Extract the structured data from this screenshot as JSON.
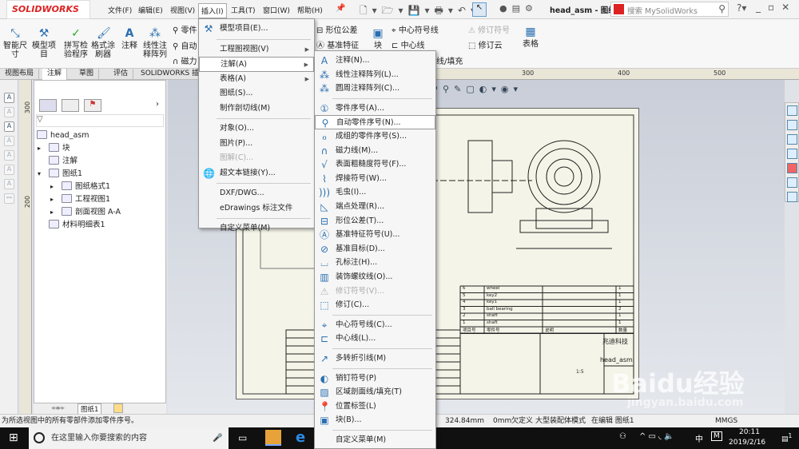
{
  "app": {
    "logo": "SOLIDWORKS",
    "doc_title": "head_asm - 图纸...",
    "search_placeholder": "搜索 MySolidWorks"
  },
  "menubar": [
    "文件(F)",
    "编辑(E)",
    "视图(V)",
    "插入(I)",
    "工具(T)",
    "窗口(W)",
    "帮助(H)"
  ],
  "ribbon": {
    "buttons": [
      "智能尺寸",
      "模型项目",
      "拼写检验程序",
      "格式涂刷器",
      "注释",
      "线性注释阵列"
    ],
    "small": [
      "零件",
      "自动",
      "磁力"
    ],
    "right_small": [
      "形位公差",
      "基准特征"
    ],
    "block": "块",
    "far": [
      "中心符号线",
      "中心线",
      "线/填充",
      "修订符号",
      "修订云"
    ],
    "table": "表格"
  },
  "tabs": [
    "视图布局",
    "注解",
    "草图",
    "评估",
    "SOLIDWORKS 插件"
  ],
  "active_tab": "注解",
  "ruler": {
    "vertical": [
      "300",
      "200"
    ],
    "horizontal": [
      "300",
      "400",
      "500"
    ]
  },
  "tree": {
    "root": "head_asm",
    "items": [
      {
        "label": "块",
        "level": 1,
        "expand": "▸"
      },
      {
        "label": "注解",
        "level": 1,
        "expand": ""
      },
      {
        "label": "图纸1",
        "level": 1,
        "expand": "▾"
      },
      {
        "label": "图纸格式1",
        "level": 2,
        "expand": "▸"
      },
      {
        "label": "工程视图1",
        "level": 2,
        "expand": "▸"
      },
      {
        "label": "剖面视图 A-A",
        "level": 2,
        "expand": "▸"
      },
      {
        "label": "材料明细表1",
        "level": 1,
        "expand": ""
      }
    ]
  },
  "sheet_tab": "图纸1",
  "insert_menu": [
    {
      "label": "模型项目(E)...",
      "icon": "model-items-icon",
      "g": "⚒"
    },
    {
      "sep": true
    },
    {
      "label": "工程图视图(V)",
      "sub": true
    },
    {
      "label": "注解(A)",
      "sub": true,
      "hl": true
    },
    {
      "label": "表格(A)",
      "sub": true
    },
    {
      "label": "图纸(S)..."
    },
    {
      "label": "制作剖切线(M)"
    },
    {
      "sep": true
    },
    {
      "label": "对象(O)..."
    },
    {
      "label": "图片(P)..."
    },
    {
      "label": "图解(C)...",
      "dis": true
    },
    {
      "label": "超文本链接(Y)...",
      "icon": "hyperlink-icon",
      "g": "🌐"
    },
    {
      "sep": true
    },
    {
      "label": "DXF/DWG..."
    },
    {
      "label": "eDrawings 标注文件"
    },
    {
      "sep": true
    },
    {
      "label": "自定义菜单(M)"
    }
  ],
  "annotation_menu": [
    {
      "label": "注释(N)...",
      "icon": "note-icon",
      "g": "A"
    },
    {
      "label": "线性注释阵列(L)...",
      "icon": "linear-note-pattern-icon",
      "g": "⁂"
    },
    {
      "label": "圆周注释阵列(C)...",
      "icon": "circular-note-pattern-icon",
      "g": "⁂"
    },
    {
      "sep": true
    },
    {
      "label": "零件序号(A)...",
      "icon": "balloon-icon",
      "g": "①"
    },
    {
      "label": "自动零件序号(N)...",
      "icon": "auto-balloon-icon",
      "g": "⚲",
      "hl": true
    },
    {
      "label": "成组的零件序号(S)...",
      "icon": "stacked-balloon-icon",
      "g": "ℴ"
    },
    {
      "label": "磁力线(M)...",
      "icon": "magnetic-line-icon",
      "g": "∩"
    },
    {
      "label": "表面粗糙度符号(F)...",
      "icon": "surface-finish-icon",
      "g": "√"
    },
    {
      "label": "焊接符号(W)...",
      "icon": "weld-symbol-icon",
      "g": "⌇"
    },
    {
      "label": "毛虫(I)...",
      "icon": "caterpillar-icon",
      "g": ")))"
    },
    {
      "label": "端点处理(R)...",
      "icon": "end-treatment-icon",
      "g": "◺"
    },
    {
      "label": "形位公差(T)...",
      "icon": "geometric-tolerance-icon",
      "g": "⊟"
    },
    {
      "label": "基准特征符号(U)...",
      "icon": "datum-feature-icon",
      "g": "Ⓐ"
    },
    {
      "label": "基准目标(D)...",
      "icon": "datum-target-icon",
      "g": "⊘"
    },
    {
      "label": "孔标注(H)...",
      "icon": "hole-callout-icon",
      "g": "⌴"
    },
    {
      "label": "装饰螺纹线(O)...",
      "icon": "cosmetic-thread-icon",
      "g": "▥"
    },
    {
      "label": "修订符号(V)...",
      "icon": "revision-symbol-icon",
      "g": "⚠",
      "dis": true
    },
    {
      "label": "修订(C)...",
      "icon": "revision-cloud-icon",
      "g": "⬚"
    },
    {
      "sep": true
    },
    {
      "label": "中心符号线(C)...",
      "icon": "center-mark-icon",
      "g": "⌖"
    },
    {
      "label": "中心线(L)...",
      "icon": "centerline-icon",
      "g": "⊏"
    },
    {
      "sep": true
    },
    {
      "label": "多转折引线(M)",
      "icon": "multi-jog-leader-icon",
      "g": "↗"
    },
    {
      "sep": true
    },
    {
      "label": "销钉符号(P)",
      "icon": "dowel-pin-icon",
      "g": "◐"
    },
    {
      "label": "区域剖面线/填充(T)",
      "icon": "area-hatch-icon",
      "g": "▨"
    },
    {
      "label": "位置标签(L)",
      "icon": "location-label-icon",
      "g": "📍"
    },
    {
      "label": "块(B)...",
      "icon": "block-icon",
      "g": "▣"
    },
    {
      "sep": true
    },
    {
      "label": "自定义菜单(M)"
    }
  ],
  "bom": {
    "rows": [
      [
        "6",
        "wheel",
        "",
        "1"
      ],
      [
        "5",
        "key2",
        "",
        "1"
      ],
      [
        "4",
        "key1",
        "",
        "1"
      ],
      [
        "3",
        "ball bearing",
        "",
        "2"
      ],
      [
        "2",
        "shaft",
        "",
        "1"
      ],
      [
        "1",
        "shaft",
        "",
        "1"
      ]
    ],
    "headers": [
      "项目号",
      "零件号",
      "说明",
      "数量"
    ],
    "company": "兆迪科技",
    "drawing_name": "head_asm",
    "scale": "1:5"
  },
  "status": {
    "message": "为所选视图中的所有零部件添加零件序号。",
    "coord": "324.84mm",
    "z": "0mm",
    "state": "欠定义",
    "mode": "大型装配体模式",
    "editing": "在编辑 图纸1",
    "units": "MMGS"
  },
  "taskbar": {
    "search": "在这里输入你要搜索的内容",
    "time": "20:11",
    "date": "2019/2/16",
    "ime": "中",
    "ime2": "M",
    "notif": "1"
  },
  "watermark": {
    "brand": "Baidu经验",
    "url": "jingyan.baidu.com"
  }
}
